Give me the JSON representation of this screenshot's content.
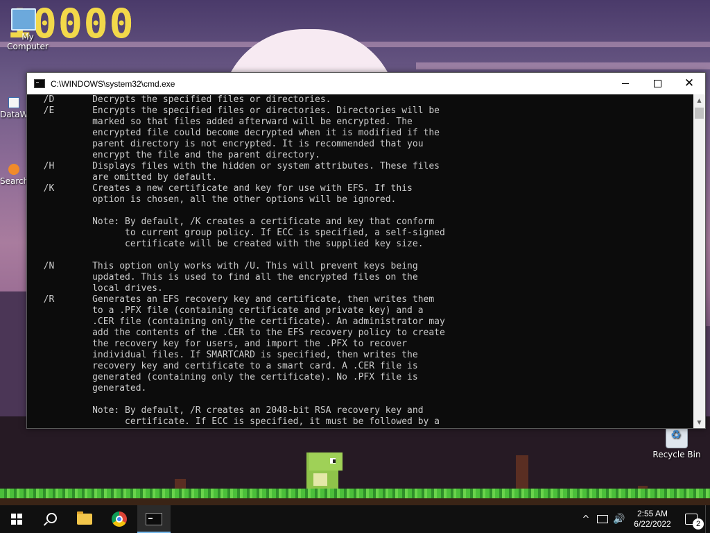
{
  "desktop": {
    "score": "10000",
    "icons": [
      {
        "label": "My Computer"
      },
      {
        "label": "DataW"
      },
      {
        "label": "Search"
      },
      {
        "label": "Recycle Bin"
      }
    ]
  },
  "cmd_window": {
    "title": "C:\\WINDOWS\\system32\\cmd.exe",
    "minimize_label": "",
    "maximize_label": "",
    "close_label": "✕",
    "lines": [
      "  /D       Decrypts the specified files or directories.",
      "  /E       Encrypts the specified files or directories. Directories will be",
      "           marked so that files added afterward will be encrypted. The",
      "           encrypted file could become decrypted when it is modified if the",
      "           parent directory is not encrypted. It is recommended that you",
      "           encrypt the file and the parent directory.",
      "  /H       Displays files with the hidden or system attributes. These files",
      "           are omitted by default.",
      "  /K       Creates a new certificate and key for use with EFS. If this",
      "           option is chosen, all the other options will be ignored.",
      "",
      "           Note: By default, /K creates a certificate and key that conform",
      "                 to current group policy. If ECC is specified, a self-signed",
      "                 certificate will be created with the supplied key size.",
      "",
      "  /N       This option only works with /U. This will prevent keys being",
      "           updated. This is used to find all the encrypted files on the",
      "           local drives.",
      "  /R       Generates an EFS recovery key and certificate, then writes them",
      "           to a .PFX file (containing certificate and private key) and a",
      "           .CER file (containing only the certificate). An administrator may",
      "           add the contents of the .CER to the EFS recovery policy to create",
      "           the recovery key for users, and import the .PFX to recover",
      "           individual files. If SMARTCARD is specified, then writes the",
      "           recovery key and certificate to a smart card. A .CER file is",
      "           generated (containing only the certificate). No .PFX file is",
      "           generated.",
      "",
      "           Note: By default, /R creates an 2048-bit RSA recovery key and",
      "                 certificate. If ECC is specified, it must be followed by a"
    ]
  },
  "taskbar": {
    "items": [
      {
        "name": "start",
        "icon": "windows-logo-icon"
      },
      {
        "name": "search",
        "icon": "search-icon"
      },
      {
        "name": "file-explorer",
        "icon": "folder-icon"
      },
      {
        "name": "chrome",
        "icon": "chrome-icon"
      },
      {
        "name": "command-prompt",
        "icon": "cmd-icon",
        "active": true
      }
    ],
    "tray": {
      "chevron": "^",
      "volume_glyph": "🔊",
      "time": "2:55 AM",
      "date": "6/22/2022",
      "notification_count": "2"
    }
  },
  "colors": {
    "console_bg": "#0c0c0c",
    "console_text": "#cccccc",
    "taskbar_bg": "#101010",
    "active_indicator": "#76b9ed",
    "score": "#f2d84a"
  }
}
